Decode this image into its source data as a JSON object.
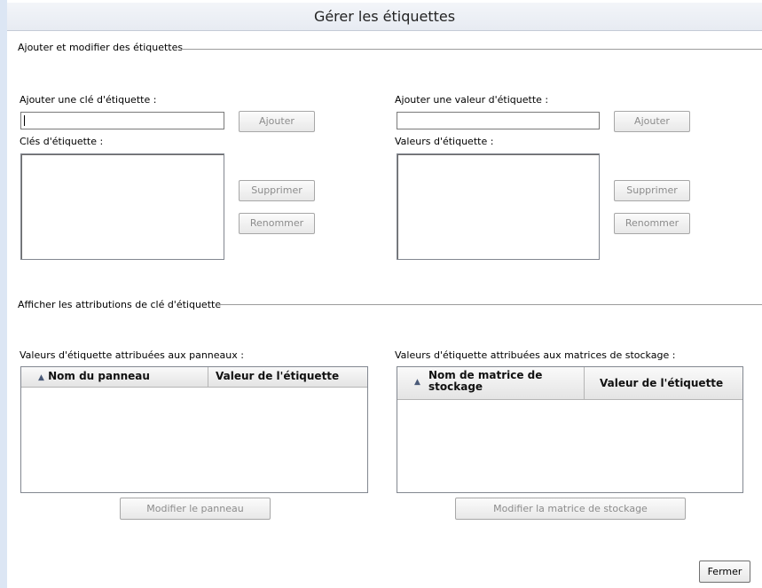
{
  "window": {
    "title": "Gérer les étiquettes"
  },
  "group_edit": {
    "title": "Ajouter et modifier des étiquettes",
    "key": {
      "add_label": "Ajouter une clé d'étiquette :",
      "add_value": "",
      "add_button": "Ajouter",
      "list_label": "Clés d'étiquette :",
      "items": [],
      "delete_button": "Supprimer",
      "rename_button": "Renommer"
    },
    "value": {
      "add_label": "Ajouter une valeur d'étiquette :",
      "add_value": "",
      "add_button": "Ajouter",
      "list_label": "Valeurs d'étiquette :",
      "items": [],
      "delete_button": "Supprimer",
      "rename_button": "Renommer"
    }
  },
  "group_assign": {
    "title": "Afficher les attributions de clé d'étiquette",
    "panels": {
      "label": "Valeurs d'étiquette attribuées aux panneaux :",
      "columns": [
        "Nom du panneau",
        "Valeur de l'étiquette"
      ],
      "rows": [],
      "edit_button": "Modifier le panneau"
    },
    "storage": {
      "label": "Valeurs d'étiquette attribuées aux matrices de stockage :",
      "columns": [
        "Nom de matrice de stockage",
        "Valeur de l'étiquette"
      ],
      "rows": [],
      "edit_button": "Modifier la matrice de stockage"
    }
  },
  "footer": {
    "close_button": "Fermer"
  },
  "icons": {
    "sort": "sort-ascending-icon"
  }
}
